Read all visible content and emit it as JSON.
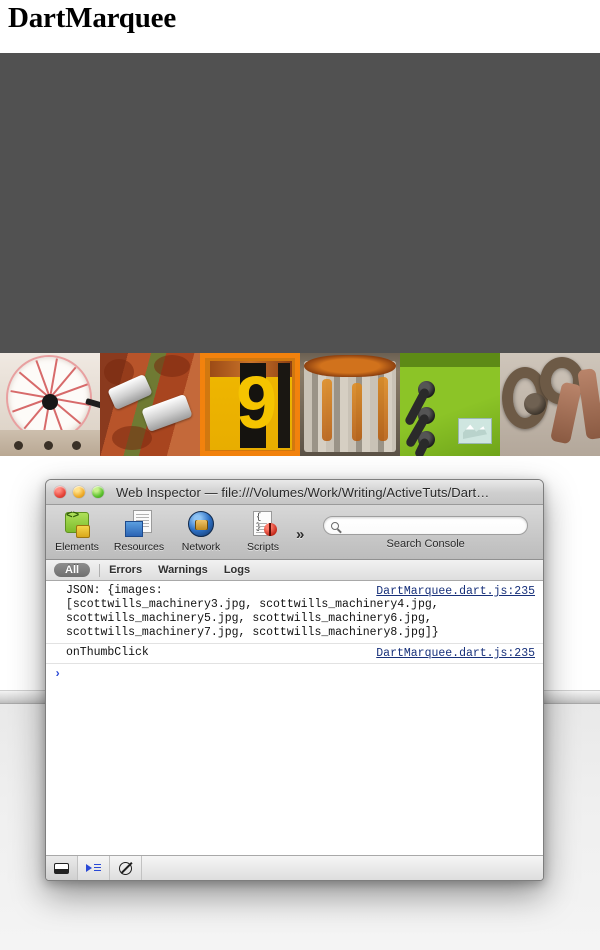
{
  "page": {
    "title": "DartMarquee",
    "stage_color": "#515151",
    "thumbnails": [
      {
        "name": "scottwills_machinery3.jpg",
        "subject": "pressure-gauge",
        "selected": false
      },
      {
        "name": "scottwills_machinery4.jpg",
        "subject": "rusty-pipes-clamps",
        "selected": false
      },
      {
        "name": "scottwills_machinery5.jpg",
        "subject": "yellow-number-nine-sign",
        "selected": true
      },
      {
        "name": "scottwills_machinery6.jpg",
        "subject": "rusty-cylinder",
        "selected": false
      },
      {
        "name": "scottwills_machinery7.jpg",
        "subject": "green-machine-cables",
        "selected": false
      },
      {
        "name": "scottwills_machinery8.jpg",
        "subject": "rusty-chain-links",
        "selected": false
      }
    ],
    "selected_accent": "#f2820d"
  },
  "inspector": {
    "window_title": "Web Inspector — file:///Volumes/Work/Writing/ActiveTuts/Dart…",
    "traffic_lights": {
      "close": "close-button",
      "minimize": "minimize-button",
      "zoom": "zoom-button"
    },
    "toolbar": {
      "items": [
        {
          "label": "Elements",
          "icon": "elements-icon"
        },
        {
          "label": "Resources",
          "icon": "resources-icon"
        },
        {
          "label": "Network",
          "icon": "network-icon"
        },
        {
          "label": "Scripts",
          "icon": "scripts-icon"
        }
      ],
      "overflow_label": "»",
      "search": {
        "value": "",
        "placeholder": "",
        "caption": "Search Console",
        "icon": "search-icon"
      }
    },
    "filters": {
      "selected": "All",
      "items": [
        "Errors",
        "Warnings",
        "Logs"
      ]
    },
    "console": {
      "messages": [
        {
          "text": "JSON: {images:\n[scottwills_machinery3.jpg, scottwills_machinery4.jpg,\nscottwills_machinery5.jpg, scottwills_machinery6.jpg,\nscottwills_machinery7.jpg, scottwills_machinery8.jpg]}",
          "source": "DartMarquee.dart.js:235"
        },
        {
          "text": "onThumbClick",
          "source": "DartMarquee.dart.js:235"
        }
      ],
      "prompt": "›",
      "link_color": "#17307a"
    },
    "statusbar": {
      "buttons": [
        {
          "icon": "dock-console-icon",
          "name": "dock-toggle"
        },
        {
          "icon": "filter-icon",
          "name": "filter-toggle"
        },
        {
          "icon": "clear-console-icon",
          "name": "clear-console"
        }
      ]
    }
  }
}
